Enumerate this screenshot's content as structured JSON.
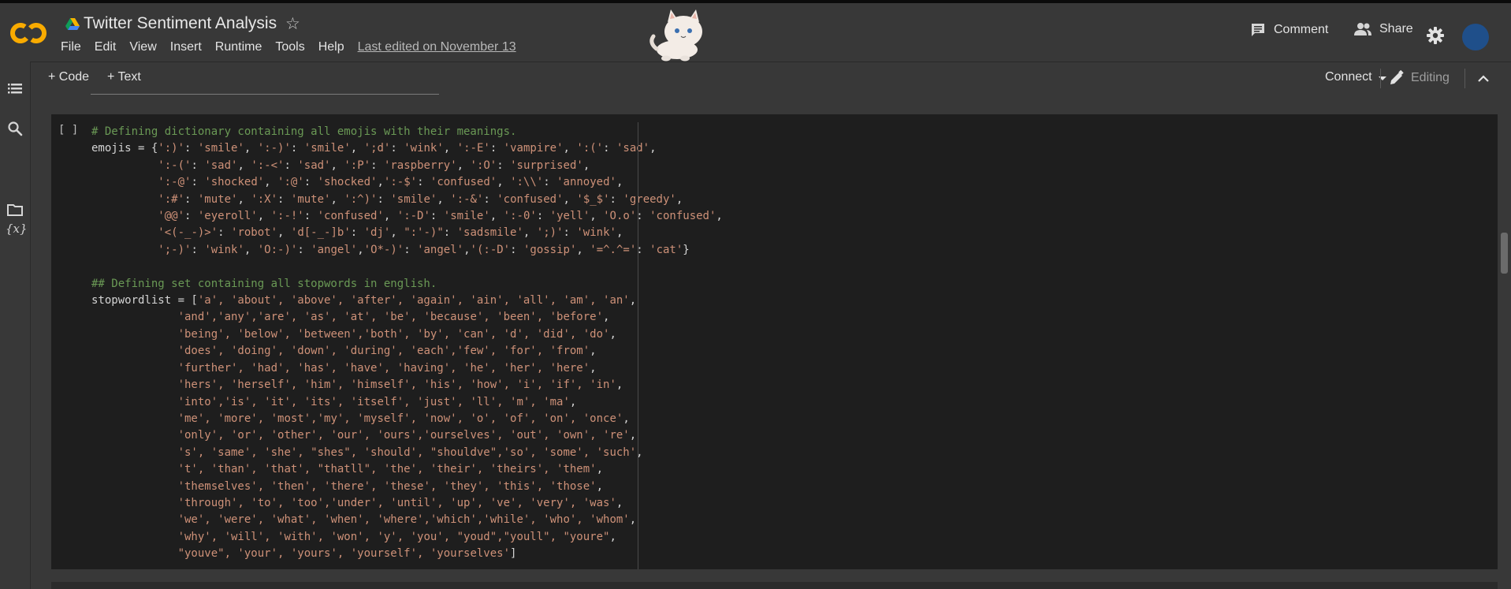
{
  "header": {
    "title": "Twitter Sentiment Analysis",
    "logo_text": "CO",
    "menu": [
      "File",
      "Edit",
      "View",
      "Insert",
      "Runtime",
      "Tools",
      "Help"
    ],
    "last_edited": "Last edited on November 13",
    "comment_label": "Comment",
    "share_label": "Share"
  },
  "toolbar": {
    "code_label": "+ Code",
    "text_label": "+ Text",
    "connect_label": "Connect",
    "editing_label": "Editing"
  },
  "sidebar": {
    "variables_label": "{x}"
  },
  "cell": {
    "run_label": "[ ]",
    "lines": [
      [
        [
          "c",
          "# Defining dictionary containing all emojis with their meanings."
        ]
      ],
      [
        [
          "p",
          "emojis = {"
        ],
        [
          "s",
          "':)'"
        ],
        [
          "p",
          ": "
        ],
        [
          "s",
          "'smile'"
        ],
        [
          "p",
          ", "
        ],
        [
          "s",
          "':-)'"
        ],
        [
          "p",
          ": "
        ],
        [
          "s",
          "'smile'"
        ],
        [
          "p",
          ", "
        ],
        [
          "s",
          "';d'"
        ],
        [
          "p",
          ": "
        ],
        [
          "s",
          "'wink'"
        ],
        [
          "p",
          ", "
        ],
        [
          "s",
          "':-E'"
        ],
        [
          "p",
          ": "
        ],
        [
          "s",
          "'vampire'"
        ],
        [
          "p",
          ", "
        ],
        [
          "s",
          "':('"
        ],
        [
          "p",
          ": "
        ],
        [
          "s",
          "'sad'"
        ],
        [
          "p",
          ","
        ]
      ],
      [
        [
          "p",
          "          "
        ],
        [
          "s",
          "':-('"
        ],
        [
          "p",
          ": "
        ],
        [
          "s",
          "'sad'"
        ],
        [
          "p",
          ", "
        ],
        [
          "s",
          "':-<'"
        ],
        [
          "p",
          ": "
        ],
        [
          "s",
          "'sad'"
        ],
        [
          "p",
          ", "
        ],
        [
          "s",
          "':P'"
        ],
        [
          "p",
          ": "
        ],
        [
          "s",
          "'raspberry'"
        ],
        [
          "p",
          ", "
        ],
        [
          "s",
          "':O'"
        ],
        [
          "p",
          ": "
        ],
        [
          "s",
          "'surprised'"
        ],
        [
          "p",
          ","
        ]
      ],
      [
        [
          "p",
          "          "
        ],
        [
          "s",
          "':-@'"
        ],
        [
          "p",
          ": "
        ],
        [
          "s",
          "'shocked'"
        ],
        [
          "p",
          ", "
        ],
        [
          "s",
          "':@'"
        ],
        [
          "p",
          ": "
        ],
        [
          "s",
          "'shocked'"
        ],
        [
          "p",
          ","
        ],
        [
          "s",
          "':-$'"
        ],
        [
          "p",
          ": "
        ],
        [
          "s",
          "'confused'"
        ],
        [
          "p",
          ", "
        ],
        [
          "s",
          "':\\\\'"
        ],
        [
          "p",
          ": "
        ],
        [
          "s",
          "'annoyed'"
        ],
        [
          "p",
          ","
        ]
      ],
      [
        [
          "p",
          "          "
        ],
        [
          "s",
          "':#'"
        ],
        [
          "p",
          ": "
        ],
        [
          "s",
          "'mute'"
        ],
        [
          "p",
          ", "
        ],
        [
          "s",
          "':X'"
        ],
        [
          "p",
          ": "
        ],
        [
          "s",
          "'mute'"
        ],
        [
          "p",
          ", "
        ],
        [
          "s",
          "':^)'"
        ],
        [
          "p",
          ": "
        ],
        [
          "s",
          "'smile'"
        ],
        [
          "p",
          ", "
        ],
        [
          "s",
          "':-&'"
        ],
        [
          "p",
          ": "
        ],
        [
          "s",
          "'confused'"
        ],
        [
          "p",
          ", "
        ],
        [
          "s",
          "'$_$'"
        ],
        [
          "p",
          ": "
        ],
        [
          "s",
          "'greedy'"
        ],
        [
          "p",
          ","
        ]
      ],
      [
        [
          "p",
          "          "
        ],
        [
          "s",
          "'@@'"
        ],
        [
          "p",
          ": "
        ],
        [
          "s",
          "'eyeroll'"
        ],
        [
          "p",
          ", "
        ],
        [
          "s",
          "':-!'"
        ],
        [
          "p",
          ": "
        ],
        [
          "s",
          "'confused'"
        ],
        [
          "p",
          ", "
        ],
        [
          "s",
          "':-D'"
        ],
        [
          "p",
          ": "
        ],
        [
          "s",
          "'smile'"
        ],
        [
          "p",
          ", "
        ],
        [
          "s",
          "':-0'"
        ],
        [
          "p",
          ": "
        ],
        [
          "s",
          "'yell'"
        ],
        [
          "p",
          ", "
        ],
        [
          "s",
          "'O.o'"
        ],
        [
          "p",
          ": "
        ],
        [
          "s",
          "'confused'"
        ],
        [
          "p",
          ","
        ]
      ],
      [
        [
          "p",
          "          "
        ],
        [
          "s",
          "'<(-_-)>'"
        ],
        [
          "p",
          ": "
        ],
        [
          "s",
          "'robot'"
        ],
        [
          "p",
          ", "
        ],
        [
          "s",
          "'d[-_-]b'"
        ],
        [
          "p",
          ": "
        ],
        [
          "s",
          "'dj'"
        ],
        [
          "p",
          ", "
        ],
        [
          "s",
          "\":'-)\""
        ],
        [
          "p",
          ": "
        ],
        [
          "s",
          "'sadsmile'"
        ],
        [
          "p",
          ", "
        ],
        [
          "s",
          "';)'"
        ],
        [
          "p",
          ": "
        ],
        [
          "s",
          "'wink'"
        ],
        [
          "p",
          ","
        ]
      ],
      [
        [
          "p",
          "          "
        ],
        [
          "s",
          "';-)'"
        ],
        [
          "p",
          ": "
        ],
        [
          "s",
          "'wink'"
        ],
        [
          "p",
          ", "
        ],
        [
          "s",
          "'O:-)'"
        ],
        [
          "p",
          ": "
        ],
        [
          "s",
          "'angel'"
        ],
        [
          "p",
          ","
        ],
        [
          "s",
          "'O*-)'"
        ],
        [
          "p",
          ": "
        ],
        [
          "s",
          "'angel'"
        ],
        [
          "p",
          ","
        ],
        [
          "s",
          "'(:-D'"
        ],
        [
          "p",
          ": "
        ],
        [
          "s",
          "'gossip'"
        ],
        [
          "p",
          ", "
        ],
        [
          "s",
          "'=^.^='"
        ],
        [
          "p",
          ": "
        ],
        [
          "s",
          "'cat'"
        ],
        [
          "p",
          "}"
        ]
      ],
      [
        [
          "p",
          ""
        ]
      ],
      [
        [
          "c",
          "## Defining set containing all stopwords in english."
        ]
      ],
      [
        [
          "p",
          "stopwordlist = ["
        ],
        [
          "s",
          "'a', 'about', 'above', 'after', 'again', 'ain', 'all', 'am', 'an'"
        ],
        [
          "p",
          ","
        ]
      ],
      [
        [
          "p",
          "             "
        ],
        [
          "s",
          "'and','any','are', 'as', 'at', 'be', 'because', 'been', 'before'"
        ],
        [
          "p",
          ","
        ]
      ],
      [
        [
          "p",
          "             "
        ],
        [
          "s",
          "'being', 'below', 'between','both', 'by', 'can', 'd', 'did', 'do'"
        ],
        [
          "p",
          ","
        ]
      ],
      [
        [
          "p",
          "             "
        ],
        [
          "s",
          "'does', 'doing', 'down', 'during', 'each','few', 'for', 'from'"
        ],
        [
          "p",
          ","
        ]
      ],
      [
        [
          "p",
          "             "
        ],
        [
          "s",
          "'further', 'had', 'has', 'have', 'having', 'he', 'her', 'here'"
        ],
        [
          "p",
          ","
        ]
      ],
      [
        [
          "p",
          "             "
        ],
        [
          "s",
          "'hers', 'herself', 'him', 'himself', 'his', 'how', 'i', 'if', 'in'"
        ],
        [
          "p",
          ","
        ]
      ],
      [
        [
          "p",
          "             "
        ],
        [
          "s",
          "'into','is', 'it', 'its', 'itself', 'just', 'll', 'm', 'ma'"
        ],
        [
          "p",
          ","
        ]
      ],
      [
        [
          "p",
          "             "
        ],
        [
          "s",
          "'me', 'more', 'most','my', 'myself', 'now', 'o', 'of', 'on', 'once'"
        ],
        [
          "p",
          ","
        ]
      ],
      [
        [
          "p",
          "             "
        ],
        [
          "s",
          "'only', 'or', 'other', 'our', 'ours','ourselves', 'out', 'own', 're'"
        ],
        [
          "p",
          ","
        ]
      ],
      [
        [
          "p",
          "             "
        ],
        [
          "s",
          "'s', 'same', 'she', \"shes\", 'should', \"shouldve\",'so', 'some', 'such'"
        ],
        [
          "p",
          ","
        ]
      ],
      [
        [
          "p",
          "             "
        ],
        [
          "s",
          "'t', 'than', 'that', \"thatll\", 'the', 'their', 'theirs', 'them'"
        ],
        [
          "p",
          ","
        ]
      ],
      [
        [
          "p",
          "             "
        ],
        [
          "s",
          "'themselves', 'then', 'there', 'these', 'they', 'this', 'those'"
        ],
        [
          "p",
          ","
        ]
      ],
      [
        [
          "p",
          "             "
        ],
        [
          "s",
          "'through', 'to', 'too','under', 'until', 'up', 've', 'very', 'was'"
        ],
        [
          "p",
          ","
        ]
      ],
      [
        [
          "p",
          "             "
        ],
        [
          "s",
          "'we', 'were', 'what', 'when', 'where','which','while', 'who', 'whom'"
        ],
        [
          "p",
          ","
        ]
      ],
      [
        [
          "p",
          "             "
        ],
        [
          "s",
          "'why', 'will', 'with', 'won', 'y', 'you', \"youd\",\"youll\", \"youre\""
        ],
        [
          "p",
          ","
        ]
      ],
      [
        [
          "p",
          "             "
        ],
        [
          "s",
          "\"youve\", 'your', 'yours', 'yourself', 'yourselves'"
        ],
        [
          "p",
          "]"
        ]
      ]
    ]
  },
  "colors": {
    "background": "#383838",
    "cell_background": "#1e1e1e",
    "comment": "#6a9955",
    "string": "#ce9178",
    "plain": "#d4d4d4",
    "logo_orange": "#f9ab00",
    "avatar": "#1f4f8a"
  },
  "icons": [
    "colab-logo",
    "drive-icon",
    "star-icon",
    "comment-icon",
    "people-icon",
    "gear-icon",
    "toc-icon",
    "search-icon",
    "variables-icon",
    "folder-icon",
    "pencil-icon",
    "caret-down-icon",
    "chevron-up-icon"
  ]
}
